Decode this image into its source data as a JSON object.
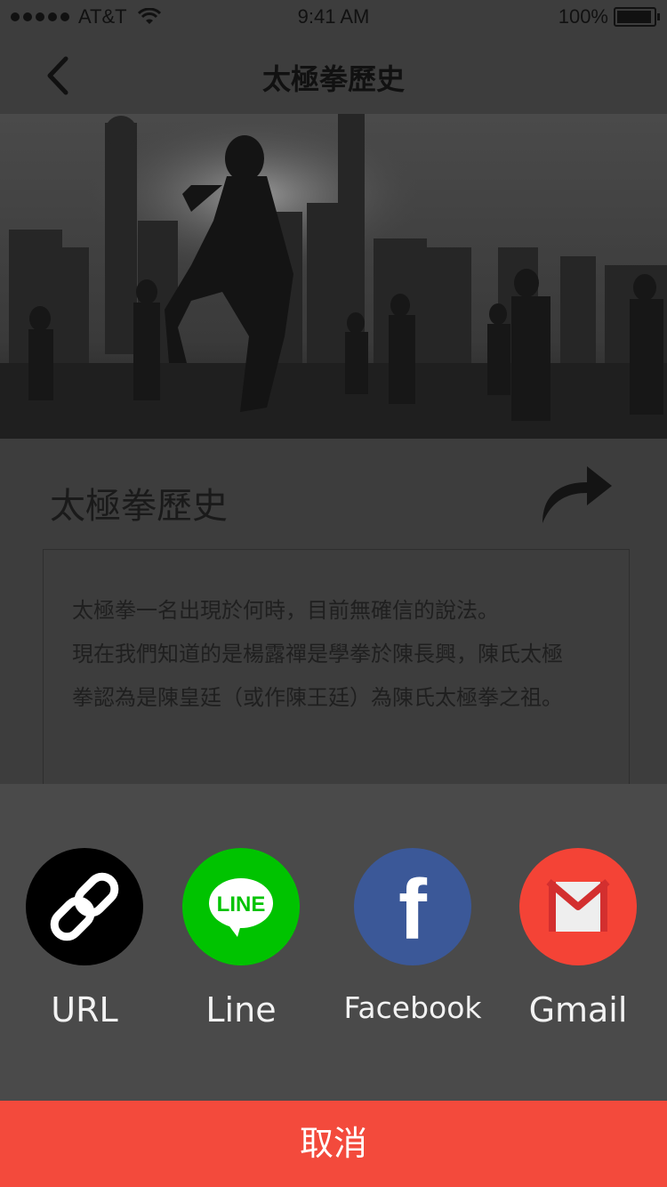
{
  "status_bar": {
    "carrier": "AT&T",
    "time": "9:41 AM",
    "battery_percent_text": "100%",
    "battery_level": 1.0,
    "signal_dots": 5,
    "wifi_icon": "wifi-icon"
  },
  "nav": {
    "back_icon": "chevron-left-icon",
    "title": "太極拳歷史"
  },
  "hero": {
    "icon": "tai-chi-skyline-photo"
  },
  "article": {
    "title": "太極拳歷史",
    "share_icon": "share-arrow-icon",
    "paragraphs": [
      "太極拳一名出現於何時，目前無確信的說法。",
      "現在我們知道的是楊露禪是學拳於陳長興，陳氏太極",
      "拳認為是陳皇廷（或作陳王廷）為陳氏太極拳之祖。"
    ]
  },
  "share_sheet": {
    "options": [
      {
        "label": "URL",
        "icon": "link-icon",
        "color": "#000000"
      },
      {
        "label": "Line",
        "icon": "line-icon",
        "icon_text": "LINE",
        "color": "#00c300"
      },
      {
        "label": "Facebook",
        "icon": "facebook-icon",
        "icon_text": "f",
        "color": "#3b5898"
      },
      {
        "label": "Gmail",
        "icon": "gmail-icon",
        "color": "#f44336"
      }
    ],
    "cancel_label": "取消",
    "cancel_color": "#f34a3c"
  }
}
